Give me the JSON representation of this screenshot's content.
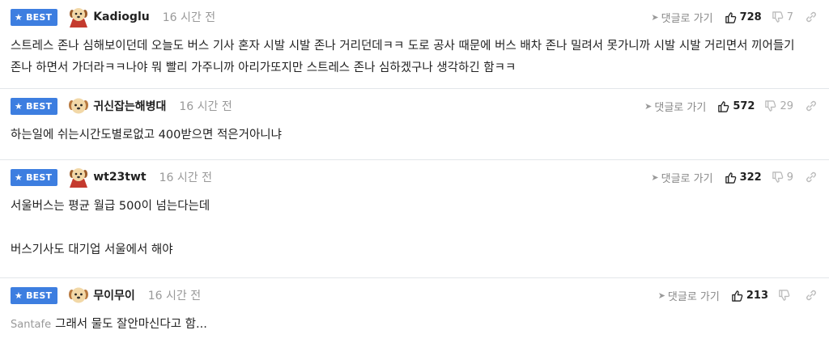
{
  "best_label": "BEST",
  "reply_label": "댓글로 가기",
  "comments": [
    {
      "nickname": "Kadioglu",
      "time": "16 시간 전",
      "upvotes": "728",
      "downvotes": "7",
      "avatar": "dog-caped-icon",
      "lines": [
        "스트레스 존나 심해보이던데 오늘도 버스 기사 혼자 시발 시발 존나 거리던데ㅋㅋ 도로 공사 때문에 버스 배차 존나 밀려서 못가니까 시발 시발 거리면서 끼어들기 존나 하면서 가더라ㅋㅋ나야 뭐 빨리 가주니까 아리가또지만 스트레스 존나 심하겠구나 생각하긴 함ㅋㅋ"
      ]
    },
    {
      "nickname": "귀신잡는해병대",
      "time": "16 시간 전",
      "upvotes": "572",
      "downvotes": "29",
      "avatar": "dog-icon",
      "lines": [
        "하는일에 쉬는시간도별로없고 400받으면 적은거아니냐"
      ]
    },
    {
      "nickname": "wt23twt",
      "time": "16 시간 전",
      "upvotes": "322",
      "downvotes": "9",
      "avatar": "dog-caped-icon",
      "lines": [
        "서울버스는 평균 월급 500이 넘는다는데",
        "",
        "버스기사도 대기업 서울에서 해야"
      ]
    },
    {
      "nickname": "무이무이",
      "time": "16 시간 전",
      "upvotes": "213",
      "downvotes": "",
      "avatar": "dog-icon",
      "device": "Santafe",
      "lines": [
        "그래서 물도 잘안마신다고 함..."
      ]
    }
  ]
}
